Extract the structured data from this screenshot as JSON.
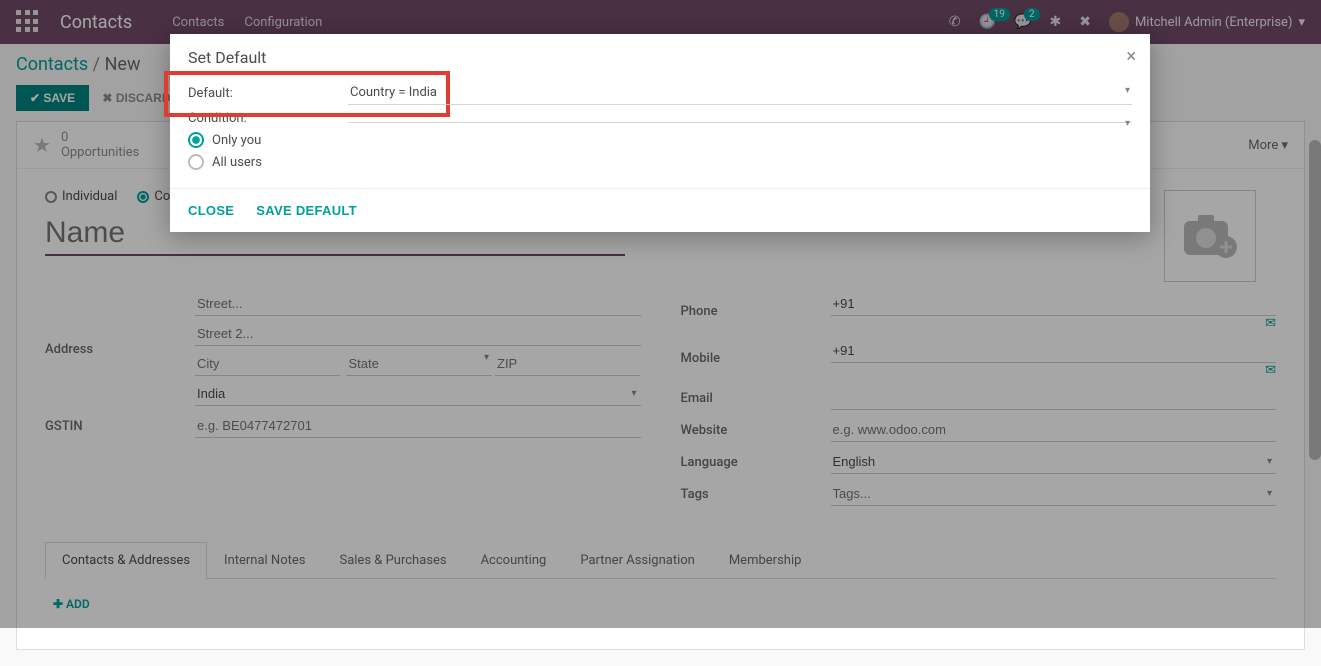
{
  "navbar": {
    "app": "Contacts",
    "links": [
      "Contacts",
      "Configuration"
    ],
    "badges": {
      "activities": "19",
      "messages": "2"
    },
    "user": "Mitchell Admin (Enterprise)"
  },
  "breadcrumb": {
    "root": "Contacts",
    "sep": "/",
    "current": "New"
  },
  "buttons": {
    "save": "SAVE",
    "discard": "DISCARD",
    "more": "More",
    "add": "ADD"
  },
  "statusbar": {
    "opp_count": "0",
    "opp_label": "Opportunities"
  },
  "company_type": {
    "individual": "Individual",
    "company": "Co"
  },
  "name_placeholder": "Name",
  "fields": {
    "address_label": "Address",
    "street_ph": "Street...",
    "street2_ph": "Street 2...",
    "city_ph": "City",
    "state_ph": "State",
    "zip_ph": "ZIP",
    "country_val": "India",
    "gstin_label": "GSTIN",
    "gstin_ph": "e.g. BE0477472701",
    "phone_label": "Phone",
    "phone_val": "+91",
    "mobile_label": "Mobile",
    "mobile_val": "+91",
    "email_label": "Email",
    "website_label": "Website",
    "website_ph": "e.g. www.odoo.com",
    "language_label": "Language",
    "language_val": "English",
    "tags_label": "Tags",
    "tags_ph": "Tags..."
  },
  "tabs": [
    "Contacts & Addresses",
    "Internal Notes",
    "Sales & Purchases",
    "Accounting",
    "Partner Assignation",
    "Membership"
  ],
  "modal": {
    "title": "Set Default",
    "default_label": "Default:",
    "default_value": "Country = India",
    "condition_label": "Condition:",
    "only_you": "Only you",
    "all_users": "All users",
    "close": "CLOSE",
    "save": "SAVE DEFAULT"
  }
}
